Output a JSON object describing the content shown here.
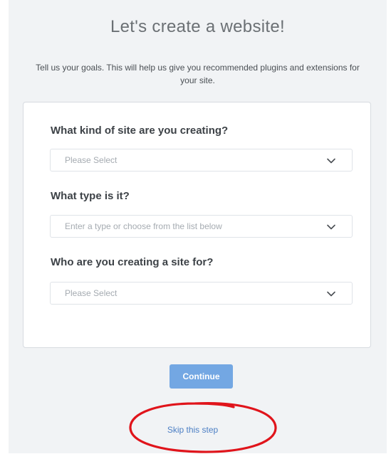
{
  "header": {
    "title": "Let's create a website!",
    "subtitle": "Tell us your goals. This will help us give you recommended plugins and extensions for your site."
  },
  "form": {
    "questions": [
      {
        "label": "What kind of site are you creating?",
        "placeholder": "Please Select"
      },
      {
        "label": "What type is it?",
        "placeholder": "Enter a type or choose from the list below"
      },
      {
        "label": "Who are you creating a site for?",
        "placeholder": "Please Select"
      }
    ]
  },
  "actions": {
    "continue_label": "Continue",
    "skip_label": "Skip this step"
  },
  "colors": {
    "background": "#f1f3f5",
    "button": "#73a7e3",
    "link": "#4c7fc4",
    "annotation": "#e0141b"
  },
  "icons": {
    "dropdown": "chevron-down-icon"
  }
}
